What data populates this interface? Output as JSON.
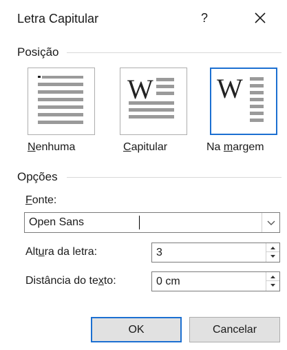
{
  "dialog": {
    "title": "Letra Capitular",
    "help_label": "?"
  },
  "position": {
    "section_label": "Posição",
    "options": [
      {
        "label": "Nenhuma",
        "mnemonic": "N",
        "rest": "enhuma"
      },
      {
        "label": "Capitular",
        "mnemonic": "C",
        "rest": "apitular"
      },
      {
        "label": "Na margem",
        "before": "Na ",
        "mnemonic": "m",
        "rest": "argem",
        "selected": true
      }
    ],
    "dropcap_letter": "W"
  },
  "options": {
    "section_label": "Opções",
    "font": {
      "label": "Fonte:",
      "mnemonic": "F",
      "rest": "onte:",
      "value": "Open Sans"
    },
    "height": {
      "label": "Altura da letra:",
      "before": "Alt",
      "mnemonic": "u",
      "rest": "ra da letra:",
      "value": "3"
    },
    "distance": {
      "label": "Distância do texto:",
      "before": "Distância do te",
      "mnemonic": "x",
      "rest": "to:",
      "value": "0 cm"
    }
  },
  "buttons": {
    "ok": "OK",
    "cancel": "Cancelar"
  },
  "colors": {
    "accent": "#1b6fd1",
    "line_gray": "#9a9a9a"
  }
}
